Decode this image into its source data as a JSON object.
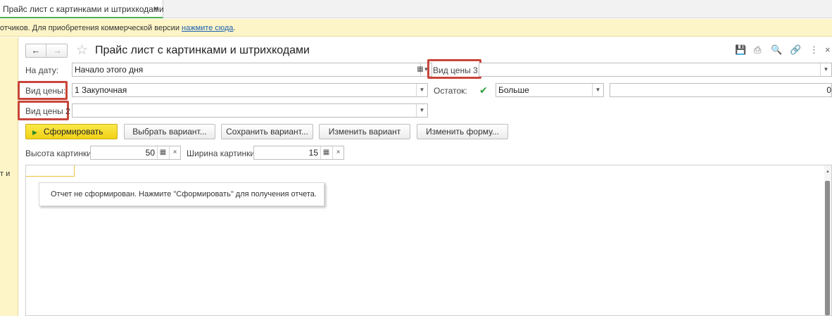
{
  "tab": {
    "title": "Прайс лист с картинками и штрихкодами",
    "close": "×"
  },
  "banner": {
    "text": "отчиков. Для приобретения коммерческой версии ",
    "link": "нажмите сюда",
    "suffix": "."
  },
  "left_panel": {
    "fragment": "т и"
  },
  "header": {
    "back": "←",
    "forward": "→",
    "star": "☆",
    "title": "Прайс лист с картинками и штрихкодами",
    "tools": {
      "save": "💾",
      "print": "⎙",
      "preview": "🔍",
      "link": "🔗",
      "more": "⋮",
      "close": "×"
    }
  },
  "fields": {
    "date_label": "На дату:",
    "date_value": "Начало этого дня",
    "price3_label": "Вид цены 3:",
    "price3_value": "",
    "price_label": "Вид цены:",
    "price_value": "1 Закупочная",
    "stock_label": "Остаток:",
    "stock_checked": "✔",
    "stock_compare": "Больше",
    "stock_value": "0",
    "price2_label": "Вид цены 2",
    "price2_value": ""
  },
  "buttons": {
    "generate": "Сформировать",
    "play": "▶",
    "choose_variant": "Выбрать вариант...",
    "save_variant": "Сохранить вариант...",
    "change_variant": "Изменить вариант",
    "change_form": "Изменить форму..."
  },
  "picture": {
    "height_label": "Высота картинки:",
    "height_value": "50",
    "width_label": "Ширина картинки:",
    "width_value": "15"
  },
  "glyphs": {
    "dropdown": "▼",
    "calendar": "▦",
    "calc": "▦",
    "clear": "×",
    "scroll_up": "▲"
  },
  "report": {
    "message": "Отчет не сформирован. Нажмите \"Сформировать\" для получения отчета."
  },
  "colors": {
    "highlight": "#c8463b",
    "accent_tab": "#4caf50",
    "banner_bg": "#fdf5c7",
    "primary_button": "#f1d116"
  }
}
